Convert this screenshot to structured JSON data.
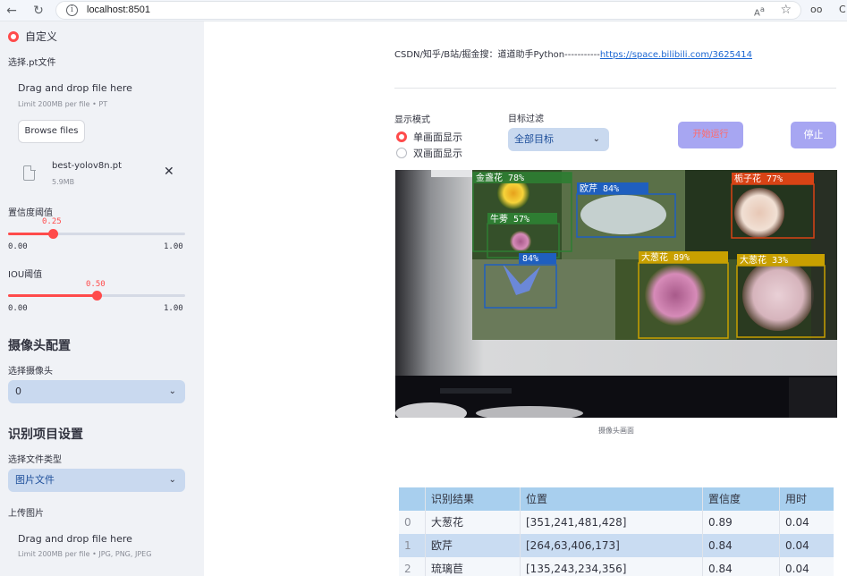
{
  "browser": {
    "url": "localhost:8501",
    "ext_label": "oo",
    "ext_label2": "C"
  },
  "sidebar": {
    "model_choice": "自定义",
    "model_file_label": "选择.pt文件",
    "model_uploader": {
      "title": "Drag and drop file here",
      "limit": "Limit 200MB per file • PT",
      "browse_label": "Browse files"
    },
    "uploaded_file": {
      "name": "best-yolov8n.pt",
      "size": "5.9MB"
    },
    "confidence": {
      "label": "置信度阈值",
      "value": "0.25",
      "value_num": 0.25,
      "min": "0.00",
      "max": "1.00"
    },
    "iou": {
      "label": "IOU阈值",
      "value": "0.50",
      "value_num": 0.5,
      "min": "0.00",
      "max": "1.00"
    },
    "camera_section": "摄像头配置",
    "camera_label": "选择摄像头",
    "camera_value": "0",
    "recognition_section": "识别项目设置",
    "file_type_label": "选择文件类型",
    "file_type_value": "图片文件",
    "upload_image_label": "上传图片",
    "image_uploader": {
      "title": "Drag and drop file here",
      "limit": "Limit 200MB per file • JPG, PNG, JPEG"
    }
  },
  "main": {
    "top_text": "CSDN/知乎/B站/掘金搜：道道助手Python-----------",
    "top_link": "https://space.bilibili.com/3625414",
    "display_mode_label": "显示模式",
    "display_modes": [
      "单画面显示",
      "双画面显示"
    ],
    "target_filter_label": "目标过滤",
    "target_filter_value": "全部目标",
    "start_button": "开始运行",
    "stop_button": "停止",
    "camera_caption": "摄像头画面",
    "detections": [
      {
        "label": "金盏花 78%",
        "color": "#2e7d32"
      },
      {
        "label": "欧芹 84%",
        "color": "#1f5fbf"
      },
      {
        "label": "牛蒡 57%",
        "color": "#2e7d32"
      },
      {
        "label": "栀子花 77%",
        "color": "#d84315"
      },
      {
        "label": "84%",
        "color": "#1f5fbf"
      },
      {
        "label": "大葱花 89%",
        "color": "#c8a000"
      },
      {
        "label": "大葱花 33%",
        "color": "#c8a000"
      }
    ]
  },
  "table": {
    "columns": [
      "识别结果",
      "位置",
      "置信度",
      "用时"
    ],
    "rows": [
      {
        "idx": "0",
        "result": "大葱花",
        "position": "[351,241,481,428]",
        "confidence": "0.89",
        "time": "0.04"
      },
      {
        "idx": "1",
        "result": "欧芹",
        "position": "[264,63,406,173]",
        "confidence": "0.84",
        "time": "0.04"
      },
      {
        "idx": "2",
        "result": "琉璃苣",
        "position": "[135,243,234,356]",
        "confidence": "0.84",
        "time": "0.04"
      }
    ]
  },
  "colors": {
    "accent": "#ff4b4b",
    "sidebar_bg": "#f0f2f6",
    "select_bg": "#c9d9ef",
    "button_bg": "#a7a6f2",
    "table_header": "#a8cfee"
  }
}
